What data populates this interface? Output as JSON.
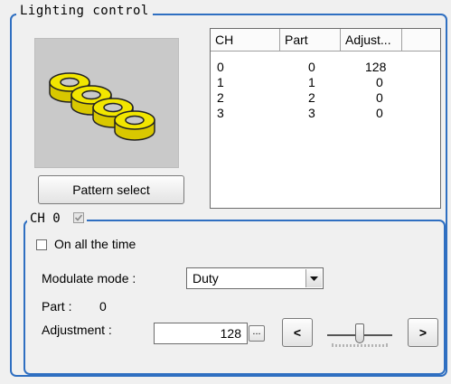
{
  "group": {
    "title": "Lighting control"
  },
  "preview": {
    "pattern_select_label": "Pattern select"
  },
  "table": {
    "columns": [
      "CH",
      "Part",
      "Adjust..."
    ],
    "rows": [
      [
        "0",
        "0",
        "128"
      ],
      [
        "1",
        "1",
        "0"
      ],
      [
        "2",
        "2",
        "0"
      ],
      [
        "3",
        "3",
        "0"
      ]
    ]
  },
  "channel": {
    "title": "CH 0",
    "enabled_checked": true,
    "always_on_label": "On all the time",
    "always_on_checked": false,
    "modulate_label": "Modulate mode :",
    "modulate_value": "Duty",
    "part_label": "Part :",
    "part_value": "0",
    "adjust_label": "Adjustment :",
    "adjust_value": "128",
    "ellipsis_label": "...",
    "prev_label": "<",
    "next_label": ">",
    "slider_level": 0.5
  },
  "colors": {
    "group_border": "#2f6fc1",
    "ring_fill": "#f2e600"
  }
}
